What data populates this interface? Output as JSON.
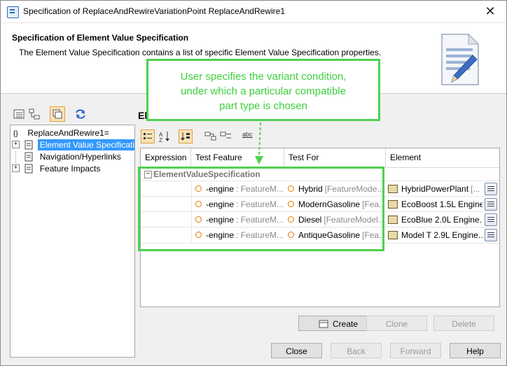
{
  "window": {
    "title": "Specification of ReplaceAndRewireVariationPoint ReplaceAndRewire1",
    "close_glyph": "✕"
  },
  "header": {
    "title": "Specification of Element Value Specification",
    "description": "The Element Value Specification contains a list of specific Element Value Specification properties."
  },
  "callout": {
    "text": "User specifies the variant condition,\nunder which a particular compatible\npart type is chosen"
  },
  "tree": {
    "root": "ReplaceAndRewire1=",
    "root_glyph": "{}",
    "items": [
      {
        "label": "Element Value Specification"
      },
      {
        "label": "Navigation/Hyperlinks"
      },
      {
        "label": "Feature Impacts"
      }
    ]
  },
  "main": {
    "section_label": "El",
    "ab_glyph": "abc"
  },
  "table": {
    "columns": [
      "Expression",
      "Test Feature",
      "Test For",
      "Element"
    ],
    "group": "ElementValueSpecification",
    "rows": [
      {
        "feature": "-engine",
        "feature_type": ": FeatureM...",
        "test_for": "Hybrid",
        "test_for_type": "[FeatureMode...",
        "element": "HybridPowerPlant",
        "element_type": "[..."
      },
      {
        "feature": "-engine",
        "feature_type": ": FeatureM...",
        "test_for": "ModernGasoline",
        "test_for_type": "[Fea...",
        "element": "EcoBoost 1.5L Engine...",
        "element_type": ""
      },
      {
        "feature": "-engine",
        "feature_type": ": FeatureM...",
        "test_for": "Diesel",
        "test_for_type": "[FeatureModel...",
        "element": "EcoBlue 2.0L Engine...",
        "element_type": ""
      },
      {
        "feature": "-engine",
        "feature_type": ": FeatureM...",
        "test_for": "AntiqueGasoline",
        "test_for_type": "[Fea...",
        "element": "Model T 2.9L Engine...",
        "element_type": ""
      }
    ]
  },
  "actions": {
    "create": "Create",
    "clone": "Clone",
    "delete": "Delete"
  },
  "footer": {
    "close": "Close",
    "back": "Back",
    "forward": "Forward",
    "help": "Help"
  },
  "colors": {
    "callout_green": "#4fd14f",
    "selection_blue": "#3399ff",
    "property_orange": "#e07b00"
  }
}
